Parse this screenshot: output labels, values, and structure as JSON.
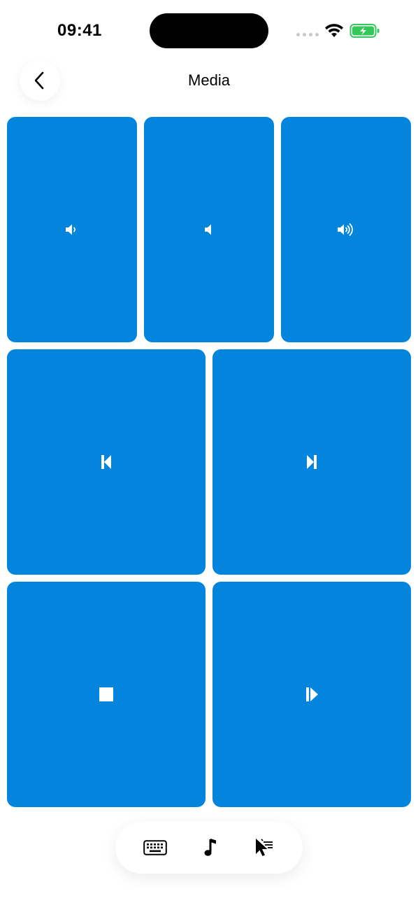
{
  "status_bar": {
    "time": "09:41",
    "icons": [
      "signal-dots-icon",
      "wifi-icon",
      "battery-charging-icon"
    ],
    "battery_color": "#34C759"
  },
  "header": {
    "title": "Media",
    "back_icon": "chevron-left-icon"
  },
  "tiles": [
    {
      "name": "volume-down-button",
      "icon": "speaker-low-icon"
    },
    {
      "name": "mute-button",
      "icon": "speaker-mute-icon"
    },
    {
      "name": "volume-up-button",
      "icon": "speaker-high-icon"
    },
    {
      "name": "previous-track-button",
      "icon": "skip-back-icon"
    },
    {
      "name": "next-track-button",
      "icon": "skip-forward-icon"
    },
    {
      "name": "stop-button",
      "icon": "stop-icon"
    },
    {
      "name": "play-pause-button",
      "icon": "play-pause-icon"
    }
  ],
  "colors": {
    "tile": "#0384DD",
    "icon": "#ffffff"
  },
  "dock": {
    "items": [
      {
        "name": "keyboard-tab",
        "icon": "keyboard-icon"
      },
      {
        "name": "media-tab",
        "icon": "music-note-icon"
      },
      {
        "name": "trackpad-tab",
        "icon": "cursor-click-icon"
      }
    ]
  }
}
